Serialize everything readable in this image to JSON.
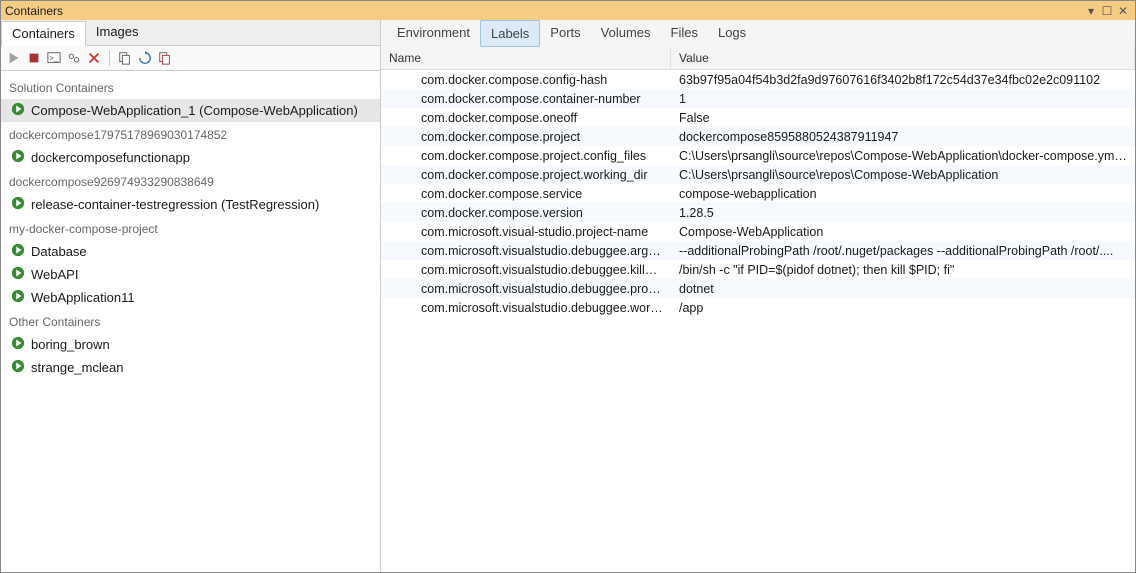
{
  "window_title": "Containers",
  "left_tabs": [
    "Containers",
    "Images"
  ],
  "left_tab_active": 0,
  "toolbar": {
    "start": "Start",
    "stop": "Stop",
    "terminal": "Open Terminal",
    "settings": "Settings",
    "delete": "Delete",
    "copy": "Copy",
    "refresh": "Refresh",
    "prune": "Prune"
  },
  "groups": [
    {
      "header": "Solution Containers",
      "items": [
        {
          "icon": "play",
          "label": "Compose-WebApplication_1 (Compose-WebApplication)",
          "selected": true
        }
      ]
    },
    {
      "header": "dockercompose17975178969030174852",
      "items": [
        {
          "icon": "play",
          "label": "dockercomposefunctionapp"
        }
      ]
    },
    {
      "header": "dockercompose926974933290838649",
      "items": [
        {
          "icon": "play",
          "label": "release-container-testregression (TestRegression)"
        }
      ]
    },
    {
      "header": "my-docker-compose-project",
      "items": [
        {
          "icon": "play",
          "label": "Database"
        },
        {
          "icon": "play",
          "label": "WebAPI"
        },
        {
          "icon": "play",
          "label": "WebApplication11"
        }
      ]
    },
    {
      "header": "Other Containers",
      "items": [
        {
          "icon": "play",
          "label": "boring_brown"
        },
        {
          "icon": "play",
          "label": "strange_mclean"
        }
      ]
    }
  ],
  "right_tabs": [
    "Environment",
    "Labels",
    "Ports",
    "Volumes",
    "Files",
    "Logs"
  ],
  "right_tab_active": 1,
  "columns": {
    "name": "Name",
    "value": "Value"
  },
  "labels": [
    {
      "name": "com.docker.compose.config-hash",
      "value": "63b97f95a04f54b3d2fa9d97607616f3402b8f172c54d37e34fbc02e2c091102"
    },
    {
      "name": "com.docker.compose.container-number",
      "value": "1"
    },
    {
      "name": "com.docker.compose.oneoff",
      "value": "False"
    },
    {
      "name": "com.docker.compose.project",
      "value": "dockercompose8595880524387911947"
    },
    {
      "name": "com.docker.compose.project.config_files",
      "value": "C:\\Users\\prsangli\\source\\repos\\Compose-WebApplication\\docker-compose.yml..."
    },
    {
      "name": "com.docker.compose.project.working_dir",
      "value": "C:\\Users\\prsangli\\source\\repos\\Compose-WebApplication"
    },
    {
      "name": "com.docker.compose.service",
      "value": "compose-webapplication"
    },
    {
      "name": "com.docker.compose.version",
      "value": "1.28.5"
    },
    {
      "name": "com.microsoft.visual-studio.project-name",
      "value": "Compose-WebApplication"
    },
    {
      "name": "com.microsoft.visualstudio.debuggee.arguments",
      "value": " --additionalProbingPath /root/.nuget/packages --additionalProbingPath /root/...."
    },
    {
      "name": "com.microsoft.visualstudio.debuggee.killprogram",
      "value": "/bin/sh -c \"if PID=$(pidof dotnet); then kill $PID; fi\""
    },
    {
      "name": "com.microsoft.visualstudio.debuggee.program",
      "value": "dotnet"
    },
    {
      "name": "com.microsoft.visualstudio.debuggee.workingdire...",
      "value": "/app"
    }
  ]
}
